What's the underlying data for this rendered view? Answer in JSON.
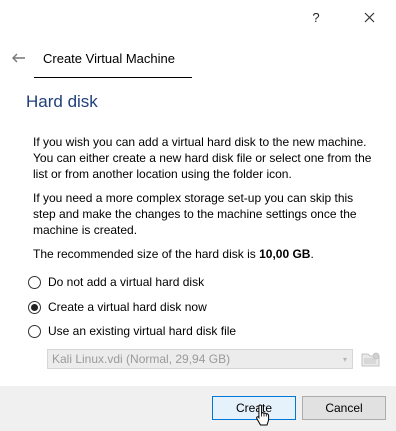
{
  "window": {
    "help_label": "?",
    "close_icon": "close-icon"
  },
  "header": {
    "back_icon": "arrow-left-icon",
    "wizard_title": "Create Virtual Machine"
  },
  "page": {
    "heading": "Hard disk",
    "paragraph_1": "If you wish you can add a virtual hard disk to the new machine. You can either create a new hard disk file or select one from the list or from another location using the folder icon.",
    "paragraph_2": "If you need a more complex storage set-up you can skip this step and make the changes to the machine settings once the machine is created.",
    "recommended_prefix": "The recommended size of the hard disk is ",
    "recommended_size": "10,00 GB",
    "recommended_suffix": "."
  },
  "options": [
    {
      "label": "Do not add a virtual hard disk",
      "selected": false
    },
    {
      "label": "Create a virtual hard disk now",
      "selected": true
    },
    {
      "label": "Use an existing virtual hard disk file",
      "selected": false
    }
  ],
  "existing_file": {
    "selected_value": "Kali Linux.vdi (Normal, 29,94 GB)",
    "enabled": false,
    "folder_icon": "folder-icon"
  },
  "buttons": {
    "create": "Create",
    "cancel": "Cancel"
  },
  "colors": {
    "heading": "#1f3f7a",
    "default_button_border": "#0078d7",
    "default_button_bg": "#e5f1fb"
  }
}
